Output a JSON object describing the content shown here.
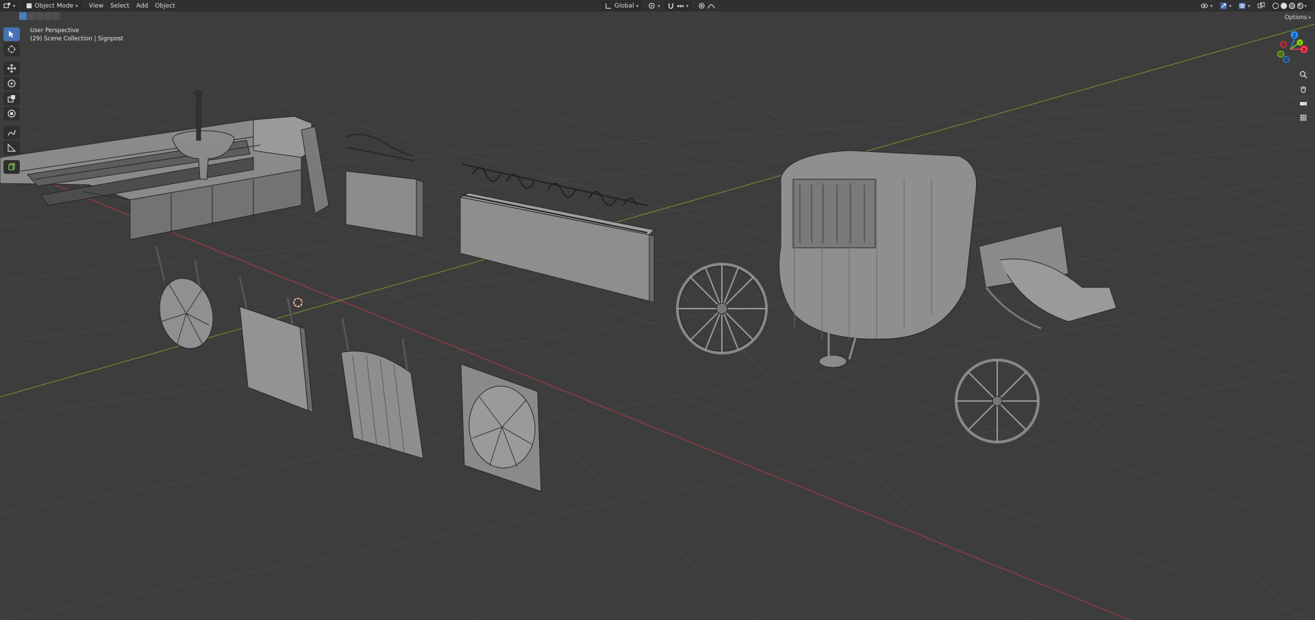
{
  "header": {
    "editor_type_icon": "editor-type-icon",
    "mode": "Object Mode",
    "menus": [
      "View",
      "Select",
      "Add",
      "Object"
    ],
    "orientation": "Global",
    "options": "Options"
  },
  "viewport": {
    "title": "User Perspective",
    "collection": "(29) Scene Collection | Signpost"
  },
  "toolbar": {
    "tools": [
      "select-box",
      "cursor",
      "move",
      "rotate",
      "scale",
      "transform",
      "annotate",
      "measure",
      "add-cube"
    ]
  },
  "gizmo": {
    "axes": [
      "X",
      "Y",
      "Z"
    ],
    "colors": {
      "x": "#ff3352",
      "y": "#8bdc00",
      "z": "#2890ff"
    }
  },
  "colors": {
    "background": "#3d3d3d",
    "header": "#303030",
    "accent": "#4772b3",
    "grid": "#484848",
    "x_axis": "#a33a46",
    "y_axis": "#6f8a2e",
    "mesh": "#8c8c8c",
    "wire": "#262626"
  }
}
